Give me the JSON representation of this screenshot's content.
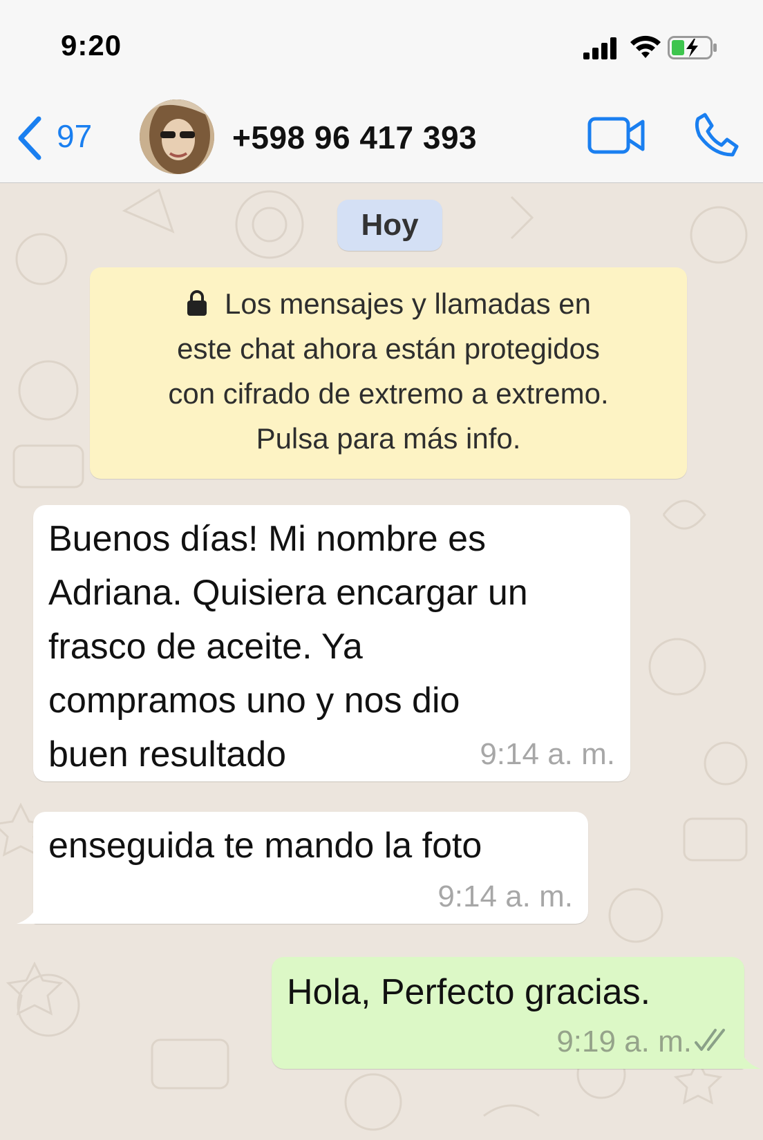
{
  "status_bar": {
    "time": "9:20"
  },
  "header": {
    "back_count": "97",
    "contact_name": "+598 96 417 393"
  },
  "chat": {
    "date_chip": "Hoy",
    "encryption_notice": {
      "lines": [
        "Los mensajes y llamadas en",
        "este chat ahora están protegidos",
        "con cifrado de extremo a extremo.",
        "Pulsa para más info."
      ]
    },
    "messages": [
      {
        "direction": "incoming",
        "lines": [
          "Buenos días! Mi nombre es",
          "Adriana. Quisiera encargar un",
          "frasco de aceite. Ya",
          "compramos uno y nos dio",
          "buen resultado"
        ],
        "time": "9:14 a. m."
      },
      {
        "direction": "incoming",
        "text": "enseguida te mando la foto",
        "time": "9:14 a. m."
      },
      {
        "direction": "outgoing",
        "text": "Hola, Perfecto gracias.",
        "time": "9:19 a. m.",
        "status": "read-double-check-icon"
      }
    ]
  },
  "colors": {
    "accent_blue": "#1a7ff0",
    "chat_background": "#ece5dd",
    "incoming_bubble": "#ffffff",
    "outgoing_bubble": "#dcf8c6",
    "notice_background": "#fdf3c4",
    "date_chip_background": "#d4e0f5"
  }
}
